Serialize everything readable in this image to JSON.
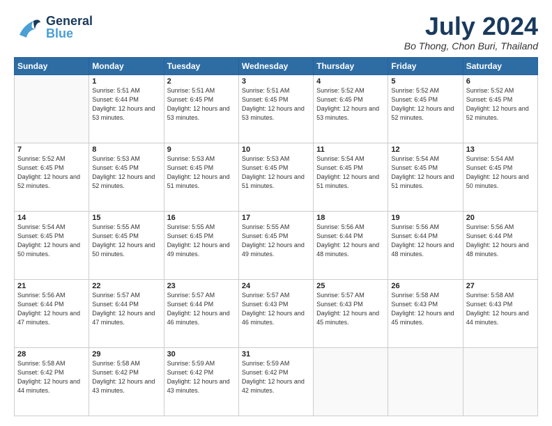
{
  "header": {
    "logo_general": "General",
    "logo_blue": "Blue",
    "month_title": "July 2024",
    "location": "Bo Thong, Chon Buri, Thailand"
  },
  "weekdays": [
    "Sunday",
    "Monday",
    "Tuesday",
    "Wednesday",
    "Thursday",
    "Friday",
    "Saturday"
  ],
  "weeks": [
    [
      {
        "day": "",
        "sunrise": "",
        "sunset": "",
        "daylight": ""
      },
      {
        "day": "1",
        "sunrise": "Sunrise: 5:51 AM",
        "sunset": "Sunset: 6:44 PM",
        "daylight": "Daylight: 12 hours and 53 minutes."
      },
      {
        "day": "2",
        "sunrise": "Sunrise: 5:51 AM",
        "sunset": "Sunset: 6:45 PM",
        "daylight": "Daylight: 12 hours and 53 minutes."
      },
      {
        "day": "3",
        "sunrise": "Sunrise: 5:51 AM",
        "sunset": "Sunset: 6:45 PM",
        "daylight": "Daylight: 12 hours and 53 minutes."
      },
      {
        "day": "4",
        "sunrise": "Sunrise: 5:52 AM",
        "sunset": "Sunset: 6:45 PM",
        "daylight": "Daylight: 12 hours and 53 minutes."
      },
      {
        "day": "5",
        "sunrise": "Sunrise: 5:52 AM",
        "sunset": "Sunset: 6:45 PM",
        "daylight": "Daylight: 12 hours and 52 minutes."
      },
      {
        "day": "6",
        "sunrise": "Sunrise: 5:52 AM",
        "sunset": "Sunset: 6:45 PM",
        "daylight": "Daylight: 12 hours and 52 minutes."
      }
    ],
    [
      {
        "day": "7",
        "sunrise": "Sunrise: 5:52 AM",
        "sunset": "Sunset: 6:45 PM",
        "daylight": "Daylight: 12 hours and 52 minutes."
      },
      {
        "day": "8",
        "sunrise": "Sunrise: 5:53 AM",
        "sunset": "Sunset: 6:45 PM",
        "daylight": "Daylight: 12 hours and 52 minutes."
      },
      {
        "day": "9",
        "sunrise": "Sunrise: 5:53 AM",
        "sunset": "Sunset: 6:45 PM",
        "daylight": "Daylight: 12 hours and 51 minutes."
      },
      {
        "day": "10",
        "sunrise": "Sunrise: 5:53 AM",
        "sunset": "Sunset: 6:45 PM",
        "daylight": "Daylight: 12 hours and 51 minutes."
      },
      {
        "day": "11",
        "sunrise": "Sunrise: 5:54 AM",
        "sunset": "Sunset: 6:45 PM",
        "daylight": "Daylight: 12 hours and 51 minutes."
      },
      {
        "day": "12",
        "sunrise": "Sunrise: 5:54 AM",
        "sunset": "Sunset: 6:45 PM",
        "daylight": "Daylight: 12 hours and 51 minutes."
      },
      {
        "day": "13",
        "sunrise": "Sunrise: 5:54 AM",
        "sunset": "Sunset: 6:45 PM",
        "daylight": "Daylight: 12 hours and 50 minutes."
      }
    ],
    [
      {
        "day": "14",
        "sunrise": "Sunrise: 5:54 AM",
        "sunset": "Sunset: 6:45 PM",
        "daylight": "Daylight: 12 hours and 50 minutes."
      },
      {
        "day": "15",
        "sunrise": "Sunrise: 5:55 AM",
        "sunset": "Sunset: 6:45 PM",
        "daylight": "Daylight: 12 hours and 50 minutes."
      },
      {
        "day": "16",
        "sunrise": "Sunrise: 5:55 AM",
        "sunset": "Sunset: 6:45 PM",
        "daylight": "Daylight: 12 hours and 49 minutes."
      },
      {
        "day": "17",
        "sunrise": "Sunrise: 5:55 AM",
        "sunset": "Sunset: 6:45 PM",
        "daylight": "Daylight: 12 hours and 49 minutes."
      },
      {
        "day": "18",
        "sunrise": "Sunrise: 5:56 AM",
        "sunset": "Sunset: 6:44 PM",
        "daylight": "Daylight: 12 hours and 48 minutes."
      },
      {
        "day": "19",
        "sunrise": "Sunrise: 5:56 AM",
        "sunset": "Sunset: 6:44 PM",
        "daylight": "Daylight: 12 hours and 48 minutes."
      },
      {
        "day": "20",
        "sunrise": "Sunrise: 5:56 AM",
        "sunset": "Sunset: 6:44 PM",
        "daylight": "Daylight: 12 hours and 48 minutes."
      }
    ],
    [
      {
        "day": "21",
        "sunrise": "Sunrise: 5:56 AM",
        "sunset": "Sunset: 6:44 PM",
        "daylight": "Daylight: 12 hours and 47 minutes."
      },
      {
        "day": "22",
        "sunrise": "Sunrise: 5:57 AM",
        "sunset": "Sunset: 6:44 PM",
        "daylight": "Daylight: 12 hours and 47 minutes."
      },
      {
        "day": "23",
        "sunrise": "Sunrise: 5:57 AM",
        "sunset": "Sunset: 6:44 PM",
        "daylight": "Daylight: 12 hours and 46 minutes."
      },
      {
        "day": "24",
        "sunrise": "Sunrise: 5:57 AM",
        "sunset": "Sunset: 6:43 PM",
        "daylight": "Daylight: 12 hours and 46 minutes."
      },
      {
        "day": "25",
        "sunrise": "Sunrise: 5:57 AM",
        "sunset": "Sunset: 6:43 PM",
        "daylight": "Daylight: 12 hours and 45 minutes."
      },
      {
        "day": "26",
        "sunrise": "Sunrise: 5:58 AM",
        "sunset": "Sunset: 6:43 PM",
        "daylight": "Daylight: 12 hours and 45 minutes."
      },
      {
        "day": "27",
        "sunrise": "Sunrise: 5:58 AM",
        "sunset": "Sunset: 6:43 PM",
        "daylight": "Daylight: 12 hours and 44 minutes."
      }
    ],
    [
      {
        "day": "28",
        "sunrise": "Sunrise: 5:58 AM",
        "sunset": "Sunset: 6:42 PM",
        "daylight": "Daylight: 12 hours and 44 minutes."
      },
      {
        "day": "29",
        "sunrise": "Sunrise: 5:58 AM",
        "sunset": "Sunset: 6:42 PM",
        "daylight": "Daylight: 12 hours and 43 minutes."
      },
      {
        "day": "30",
        "sunrise": "Sunrise: 5:59 AM",
        "sunset": "Sunset: 6:42 PM",
        "daylight": "Daylight: 12 hours and 43 minutes."
      },
      {
        "day": "31",
        "sunrise": "Sunrise: 5:59 AM",
        "sunset": "Sunset: 6:42 PM",
        "daylight": "Daylight: 12 hours and 42 minutes."
      },
      {
        "day": "",
        "sunrise": "",
        "sunset": "",
        "daylight": ""
      },
      {
        "day": "",
        "sunrise": "",
        "sunset": "",
        "daylight": ""
      },
      {
        "day": "",
        "sunrise": "",
        "sunset": "",
        "daylight": ""
      }
    ]
  ]
}
